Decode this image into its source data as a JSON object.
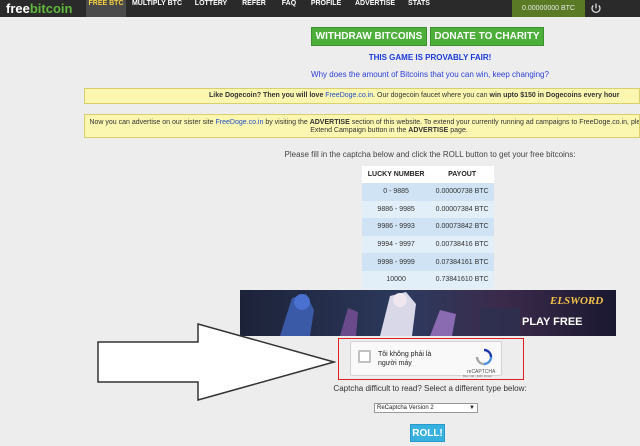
{
  "nav": {
    "logo_part1": "free",
    "logo_part2": "bitcoin",
    "items": [
      "FREE BTC",
      "MULTIPLY BTC",
      "LOTTERY",
      "REFER",
      "FAQ",
      "PROFILE",
      "ADVERTISE",
      "STATS"
    ],
    "balance": "0.00000000 BTC",
    "power_icon": "power-icon"
  },
  "buttons": {
    "withdraw": "WITHDRAW BITCOINS",
    "donate": "DONATE TO CHARITY"
  },
  "fair_text": "THIS GAME IS PROVABLY FAIR!",
  "why_text": "Why does the amount of Bitcoins that you can win, keep changing?",
  "dogecoin_notice": {
    "pre": "Like Dogecoin? Then you will love ",
    "link": "FreeDoge.co.in",
    "mid": ". Our dogecoin faucet where you can ",
    "bold": "win upto $150 in Dogecoins every hour"
  },
  "advertise_notice": {
    "pre": "Now you can advertise on our sister site ",
    "link": "FreeDoge.co.in",
    "mid1": " by visiting the ",
    "adv1": "ADVERTISE",
    "mid2": " section of this website. To extend your currently running ad campaigns to FreeDoge.co.in, please click on the Extend Campaign button in the ",
    "adv2": "ADVERTISE",
    "end": " page."
  },
  "instructions": "Please fill in the captcha below and click the ROLL button to get your free bitcoins:",
  "payout_table": {
    "headers": [
      "LUCKY NUMBER",
      "PAYOUT"
    ],
    "rows": [
      [
        "0 - 9885",
        "0.00000738 BTC"
      ],
      [
        "9886 - 9985",
        "0.00007384 BTC"
      ],
      [
        "9986 - 9993",
        "0.00073842 BTC"
      ],
      [
        "9994 - 9997",
        "0.00738416 BTC"
      ],
      [
        "9998 - 9999",
        "0.07384161 BTC"
      ],
      [
        "10000",
        "0.73841610 BTC"
      ]
    ]
  },
  "ad_banner": {
    "brand": "ELSWORD",
    "cta": "PLAY FREE"
  },
  "captcha": {
    "label": "Tôi không phải là người máy",
    "brand": "reCAPTCHA",
    "terms": "Bảo mật - Điều khoản"
  },
  "difficult_text": "Captcha difficult to read? Select a different type below:",
  "captcha_type_select": "ReCaptcha Version 2",
  "roll_label": "ROLL!",
  "colors": {
    "nav_bg": "#2a2a2a",
    "green": "#4caf3a",
    "yellow_notice": "#fbf7b0",
    "roll_blue": "#37b1e0",
    "highlight_red": "#e02020"
  }
}
